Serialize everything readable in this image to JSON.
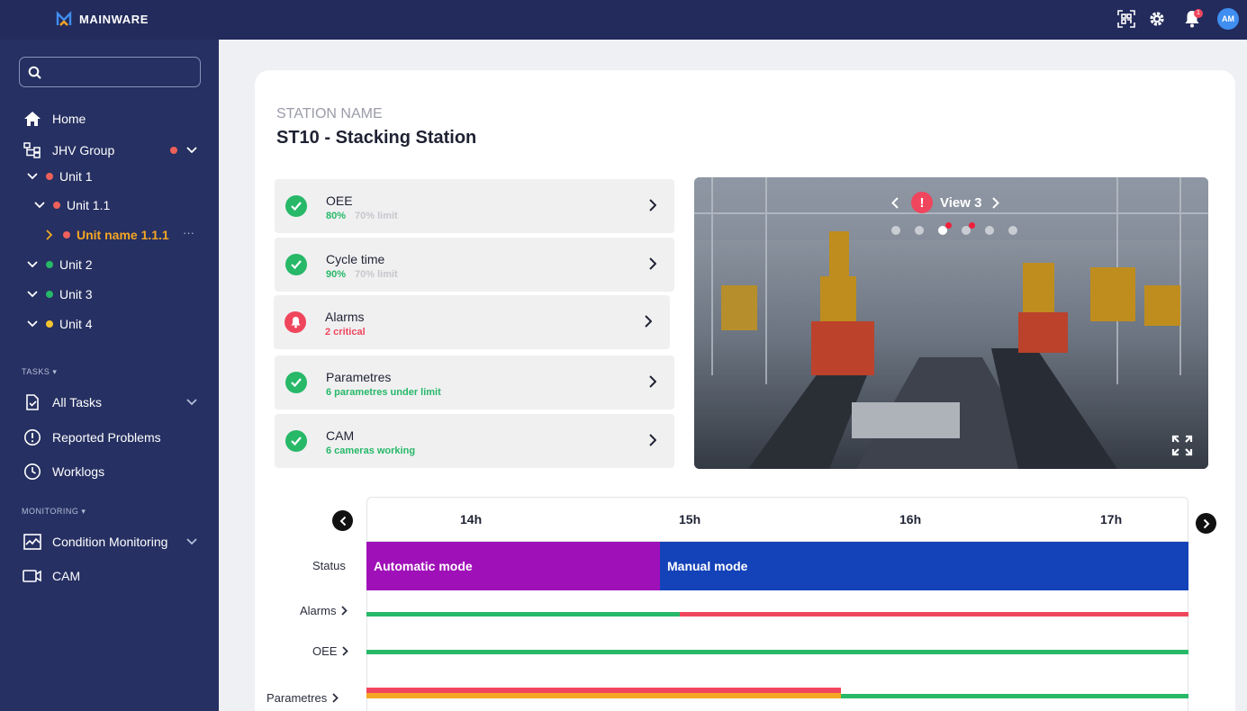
{
  "app": {
    "brand": "MAINWARE"
  },
  "topbar": {
    "icons": [
      "qr-scan-icon",
      "gear-icon",
      "bell-icon"
    ],
    "notification_count": "1",
    "avatar_initials": "AM"
  },
  "sidebar": {
    "search_placeholder": "",
    "home": "Home",
    "group": {
      "label": "JHV Group",
      "status_color": "#f0605a"
    },
    "tree": [
      {
        "label": "Unit 1",
        "status_color": "#f0605a"
      },
      {
        "label": "Unit 1.1",
        "status_color": "#f0605a"
      },
      {
        "label": "Unit name 1.1.1",
        "status_color": "#f0605a",
        "selected": true,
        "more": "···"
      },
      {
        "label": "Unit 2",
        "status_color": "#27b868"
      },
      {
        "label": "Unit 3",
        "status_color": "#27b868"
      },
      {
        "label": "Unit 4",
        "status_color": "#f5c531"
      }
    ],
    "tasks_section": "TASKS",
    "tasks": [
      "All Tasks",
      "Reported Problems",
      "Worklogs"
    ],
    "monitoring_section": "MONITORING",
    "monitoring": [
      "Condition Monitoring",
      "CAM"
    ]
  },
  "station": {
    "label": "STATION NAME",
    "title": "ST10 - Stacking Station"
  },
  "cards": [
    {
      "title": "OEE",
      "value": "80%",
      "limit": "70% limit",
      "status": "ok"
    },
    {
      "title": "Cycle time",
      "value": "90%",
      "limit": "70% limit",
      "status": "ok"
    },
    {
      "title": "Alarms",
      "value": "2 critical",
      "limit": "",
      "status": "alarm"
    },
    {
      "title": "Parametres",
      "value": "6 parametres under limit",
      "limit": "",
      "status": "ok"
    },
    {
      "title": "CAM",
      "value": "6 cameras working",
      "limit": "",
      "status": "ok"
    }
  ],
  "camera": {
    "view_label": "View 3",
    "alert_symbol": "!",
    "dot_count": 6,
    "active_dot": 2
  },
  "timeline": {
    "hours": [
      "14h",
      "15h",
      "16h",
      "17h"
    ],
    "rows": {
      "status": "Status",
      "alarms": "Alarms",
      "oee": "OEE",
      "parametres": "Parametres"
    },
    "status_segments": [
      {
        "label": "Automatic mode",
        "color": "#a010b8"
      },
      {
        "label": "Manual mode",
        "color": "#1442b8"
      }
    ],
    "colors": {
      "ok": "#27b868",
      "alarm": "#f0465d",
      "warn": "#f5a623"
    }
  }
}
